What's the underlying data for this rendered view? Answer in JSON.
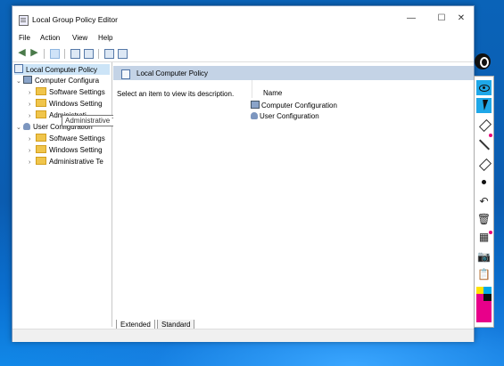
{
  "window": {
    "title": "Local Group Policy Editor",
    "minimize_glyph": "—",
    "maximize_glyph": "☐",
    "close_glyph": "✕"
  },
  "menu": [
    "File",
    "Action",
    "View",
    "Help"
  ],
  "tree": {
    "root": "Local Computer Policy",
    "computer_config": "Computer Configura",
    "cc_software": "Software Settings",
    "cc_windows": "Windows Setting",
    "cc_admin": "Administrati",
    "user_config": "User Configuration",
    "uc_software": "Software Settings",
    "uc_windows": "Windows Setting",
    "uc_admin": "Administrative Te"
  },
  "tooltip": "Administrative Templates",
  "right_pane": {
    "header": "Local Computer Policy",
    "description": "Select an item to view its description.",
    "column_name": "Name",
    "items": [
      "Computer Configuration",
      "User Configuration"
    ]
  },
  "tabs": [
    "Extended",
    "Standard"
  ],
  "icons": {
    "back": "back-arrow-icon",
    "forward": "forward-arrow-icon"
  },
  "colors": {
    "desktop": "#0b5cb0",
    "selection": "#cce4f7",
    "header_band": "#c4d3e6",
    "pen_active": "#1ea7e8",
    "folder": "#f0c54b"
  }
}
